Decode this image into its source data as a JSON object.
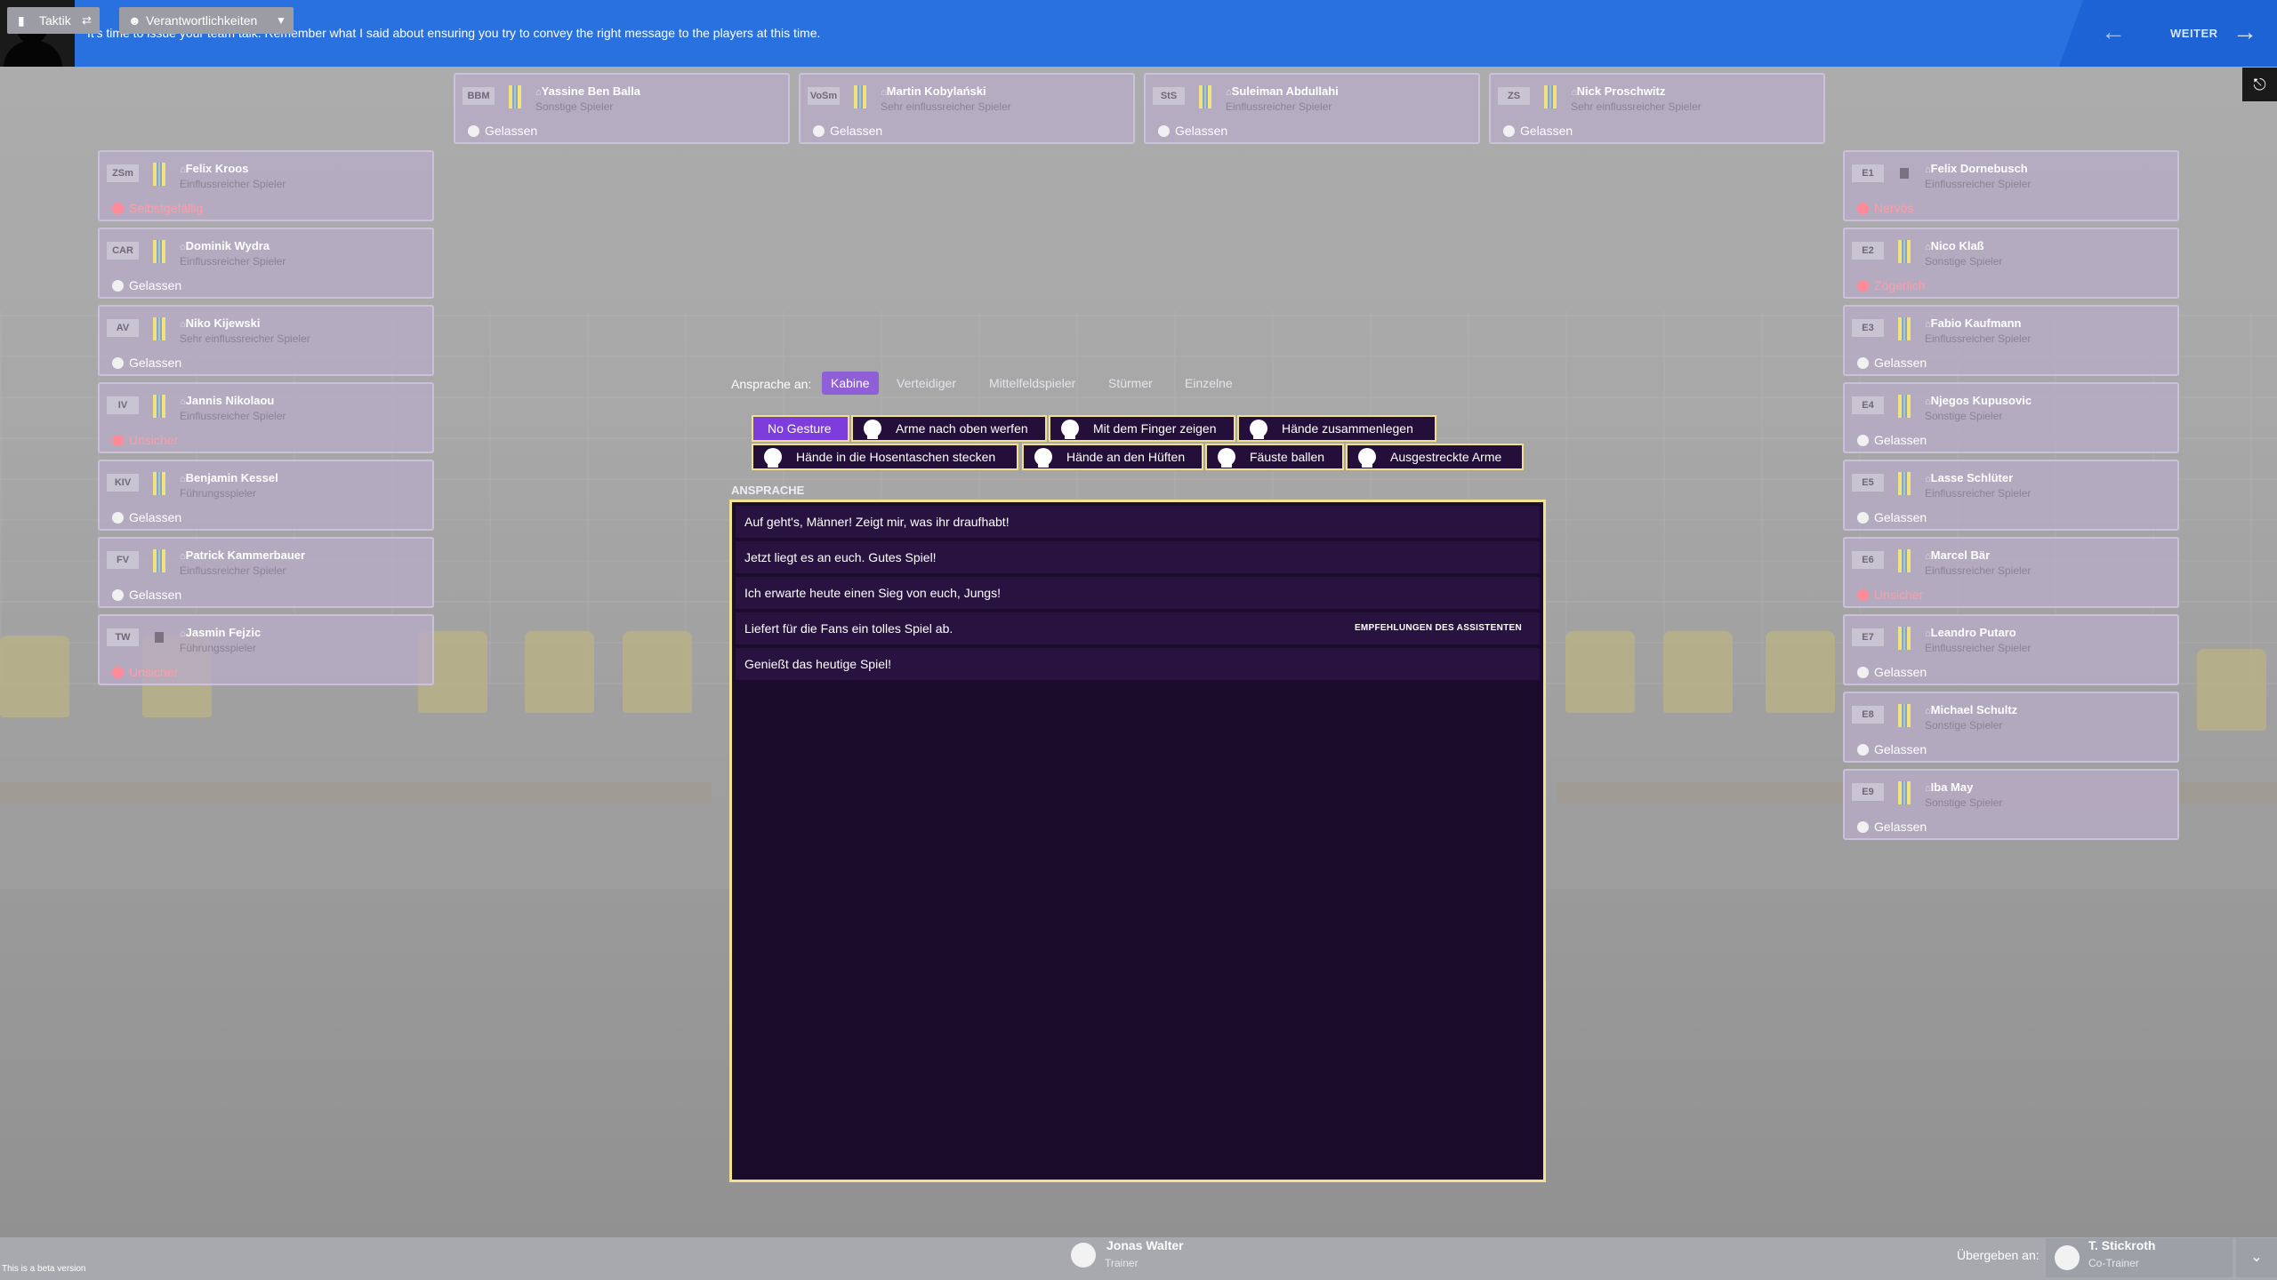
{
  "topbar": {
    "message": "It's time to issue your team talk. Remember what I said about ensuring you try to convey the right message to the players at this time.",
    "back_icon": "arrow-left-icon",
    "continue_label": "WEITER",
    "continue_icon": "arrow-right-icon",
    "exit_icon": "exit-icon"
  },
  "top_players": [
    {
      "pos": "BBM",
      "name": "Yassine Ben Balla",
      "role": "Sonstige Spieler",
      "mood": "Gelassen",
      "mood_type": "calm"
    },
    {
      "pos": "VoSm",
      "name": "Martin Kobylański",
      "role": "Sehr einflussreicher Spieler",
      "mood": "Gelassen",
      "mood_type": "calm"
    },
    {
      "pos": "StS",
      "name": "Suleiman Abdullahi",
      "role": "Einflussreicher Spieler",
      "mood": "Gelassen",
      "mood_type": "calm"
    },
    {
      "pos": "ZS",
      "name": "Nick Proschwitz",
      "role": "Sehr einflussreicher Spieler",
      "mood": "Gelassen",
      "mood_type": "calm"
    }
  ],
  "left_players": [
    {
      "pos": "ZSm",
      "name": "Felix Kroos",
      "role": "Einflussreicher Spieler",
      "mood": "Selbstgefällig",
      "mood_type": "bad"
    },
    {
      "pos": "CAR",
      "name": "Dominik Wydra",
      "role": "Einflussreicher Spieler",
      "mood": "Gelassen",
      "mood_type": "calm"
    },
    {
      "pos": "AV",
      "name": "Niko Kijewski",
      "role": "Sehr einflussreicher Spieler",
      "mood": "Gelassen",
      "mood_type": "calm"
    },
    {
      "pos": "IV",
      "name": "Jannis Nikolaou",
      "role": "Einflussreicher Spieler",
      "mood": "Unsicher",
      "mood_type": "bad"
    },
    {
      "pos": "KIV",
      "name": "Benjamin Kessel",
      "role": "Führungsspieler",
      "mood": "Gelassen",
      "mood_type": "calm"
    },
    {
      "pos": "FV",
      "name": "Patrick Kammerbauer",
      "role": "Einflussreicher Spieler",
      "mood": "Gelassen",
      "mood_type": "calm"
    },
    {
      "pos": "TW",
      "name": "Jasmin Fejzic",
      "role": "Führungsspieler",
      "mood": "Unsicher",
      "mood_type": "bad"
    }
  ],
  "right_players": [
    {
      "pos": "E1",
      "name": "Felix Dornebusch",
      "role": "Einflussreicher Spieler",
      "mood": "Nervös",
      "mood_type": "bad"
    },
    {
      "pos": "E2",
      "name": "Nico Klaß",
      "role": "Sonstige Spieler",
      "mood": "Zögerlich",
      "mood_type": "bad"
    },
    {
      "pos": "E3",
      "name": "Fabio Kaufmann",
      "role": "Einflussreicher Spieler",
      "mood": "Gelassen",
      "mood_type": "calm"
    },
    {
      "pos": "E4",
      "name": "Njegos Kupusovic",
      "role": "Sonstige Spieler",
      "mood": "Gelassen",
      "mood_type": "calm"
    },
    {
      "pos": "E5",
      "name": "Lasse Schlüter",
      "role": "Einflussreicher Spieler",
      "mood": "Gelassen",
      "mood_type": "calm"
    },
    {
      "pos": "E6",
      "name": "Marcel Bär",
      "role": "Einflussreicher Spieler",
      "mood": "Unsicher",
      "mood_type": "bad"
    },
    {
      "pos": "E7",
      "name": "Leandro Putaro",
      "role": "Einflussreicher Spieler",
      "mood": "Gelassen",
      "mood_type": "calm"
    },
    {
      "pos": "E8",
      "name": "Michael Schultz",
      "role": "Sonstige Spieler",
      "mood": "Gelassen",
      "mood_type": "calm"
    },
    {
      "pos": "E9",
      "name": "Iba May",
      "role": "Sonstige Spieler",
      "mood": "Gelassen",
      "mood_type": "calm"
    }
  ],
  "talk": {
    "target_label": "Ansprache an:",
    "tabs": [
      "Kabine",
      "Verteidiger",
      "Mittelfeldspieler",
      "Stürmer",
      "Einzelne"
    ],
    "gestures": [
      "No Gesture",
      "Arme nach oben werfen",
      "Mit dem Finger zeigen",
      "Hände zusammenlegen",
      "Hände in die Hosentaschen stecken",
      "Hände an den Hüften",
      "Fäuste ballen",
      "Ausgestreckte Arme"
    ],
    "section_label": "ANSPRACHE",
    "options": [
      "Auf geht's, Männer! Zeigt mir, was ihr draufhabt!",
      "Jetzt liegt es an euch. Gutes Spiel!",
      "Ich erwarte heute einen Sieg von euch, Jungs!",
      "Liefert für die Fans ein tolles Spiel ab.",
      "Genießt das heutige Spiel!"
    ],
    "recommendation": "EMPFEHLUNGEN DES ASSISTENTEN"
  },
  "bottom": {
    "tactics_label": "Taktik",
    "responsibilities_label": "Verantwortlichkeiten",
    "beta_note": "This is a beta version",
    "manager_name": "Jonas Walter",
    "manager_role": "Trainer",
    "handover_label": "Übergeben an:",
    "assistant_name": "T. Stickroth",
    "assistant_role": "Co-Trainer"
  }
}
